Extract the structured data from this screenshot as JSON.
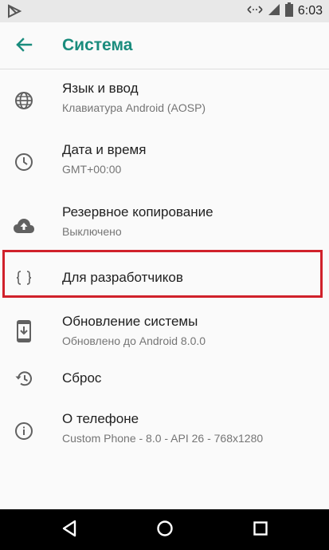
{
  "status_bar": {
    "time": "6:03",
    "icons": [
      "play-store-notification-icon",
      "data-transfer-icon",
      "signal-icon",
      "battery-icon"
    ]
  },
  "app_bar": {
    "title": "Система",
    "back_icon": "arrow-back-icon"
  },
  "colors": {
    "accent": "#1a8c7d",
    "highlight": "#d0212b",
    "text_primary": "#212121",
    "text_secondary": "#757575",
    "icon": "#616161"
  },
  "items": [
    {
      "title": "Язык и ввод",
      "subtitle": "Клавиатура Android (AOSP)",
      "icon": "globe-icon"
    },
    {
      "title": "Дата и время",
      "subtitle": "GMT+00:00",
      "icon": "clock-icon"
    },
    {
      "title": "Резервное копирование",
      "subtitle": "Выключено",
      "icon": "cloud-upload-icon"
    },
    {
      "title": "Для разработчиков",
      "subtitle": "",
      "icon": "code-braces-icon"
    },
    {
      "title": "Обновление системы",
      "subtitle": "Обновлено до Android 8.0.0",
      "icon": "system-update-icon"
    },
    {
      "title": "Сброс",
      "subtitle": "",
      "icon": "restore-icon"
    },
    {
      "title": "О телефоне",
      "subtitle": "Custom Phone - 8.0 - API 26 - 768x1280",
      "icon": "info-icon"
    }
  ],
  "nav_bar": {
    "icons": [
      "back-triangle-icon",
      "home-circle-icon",
      "recents-square-icon"
    ]
  }
}
